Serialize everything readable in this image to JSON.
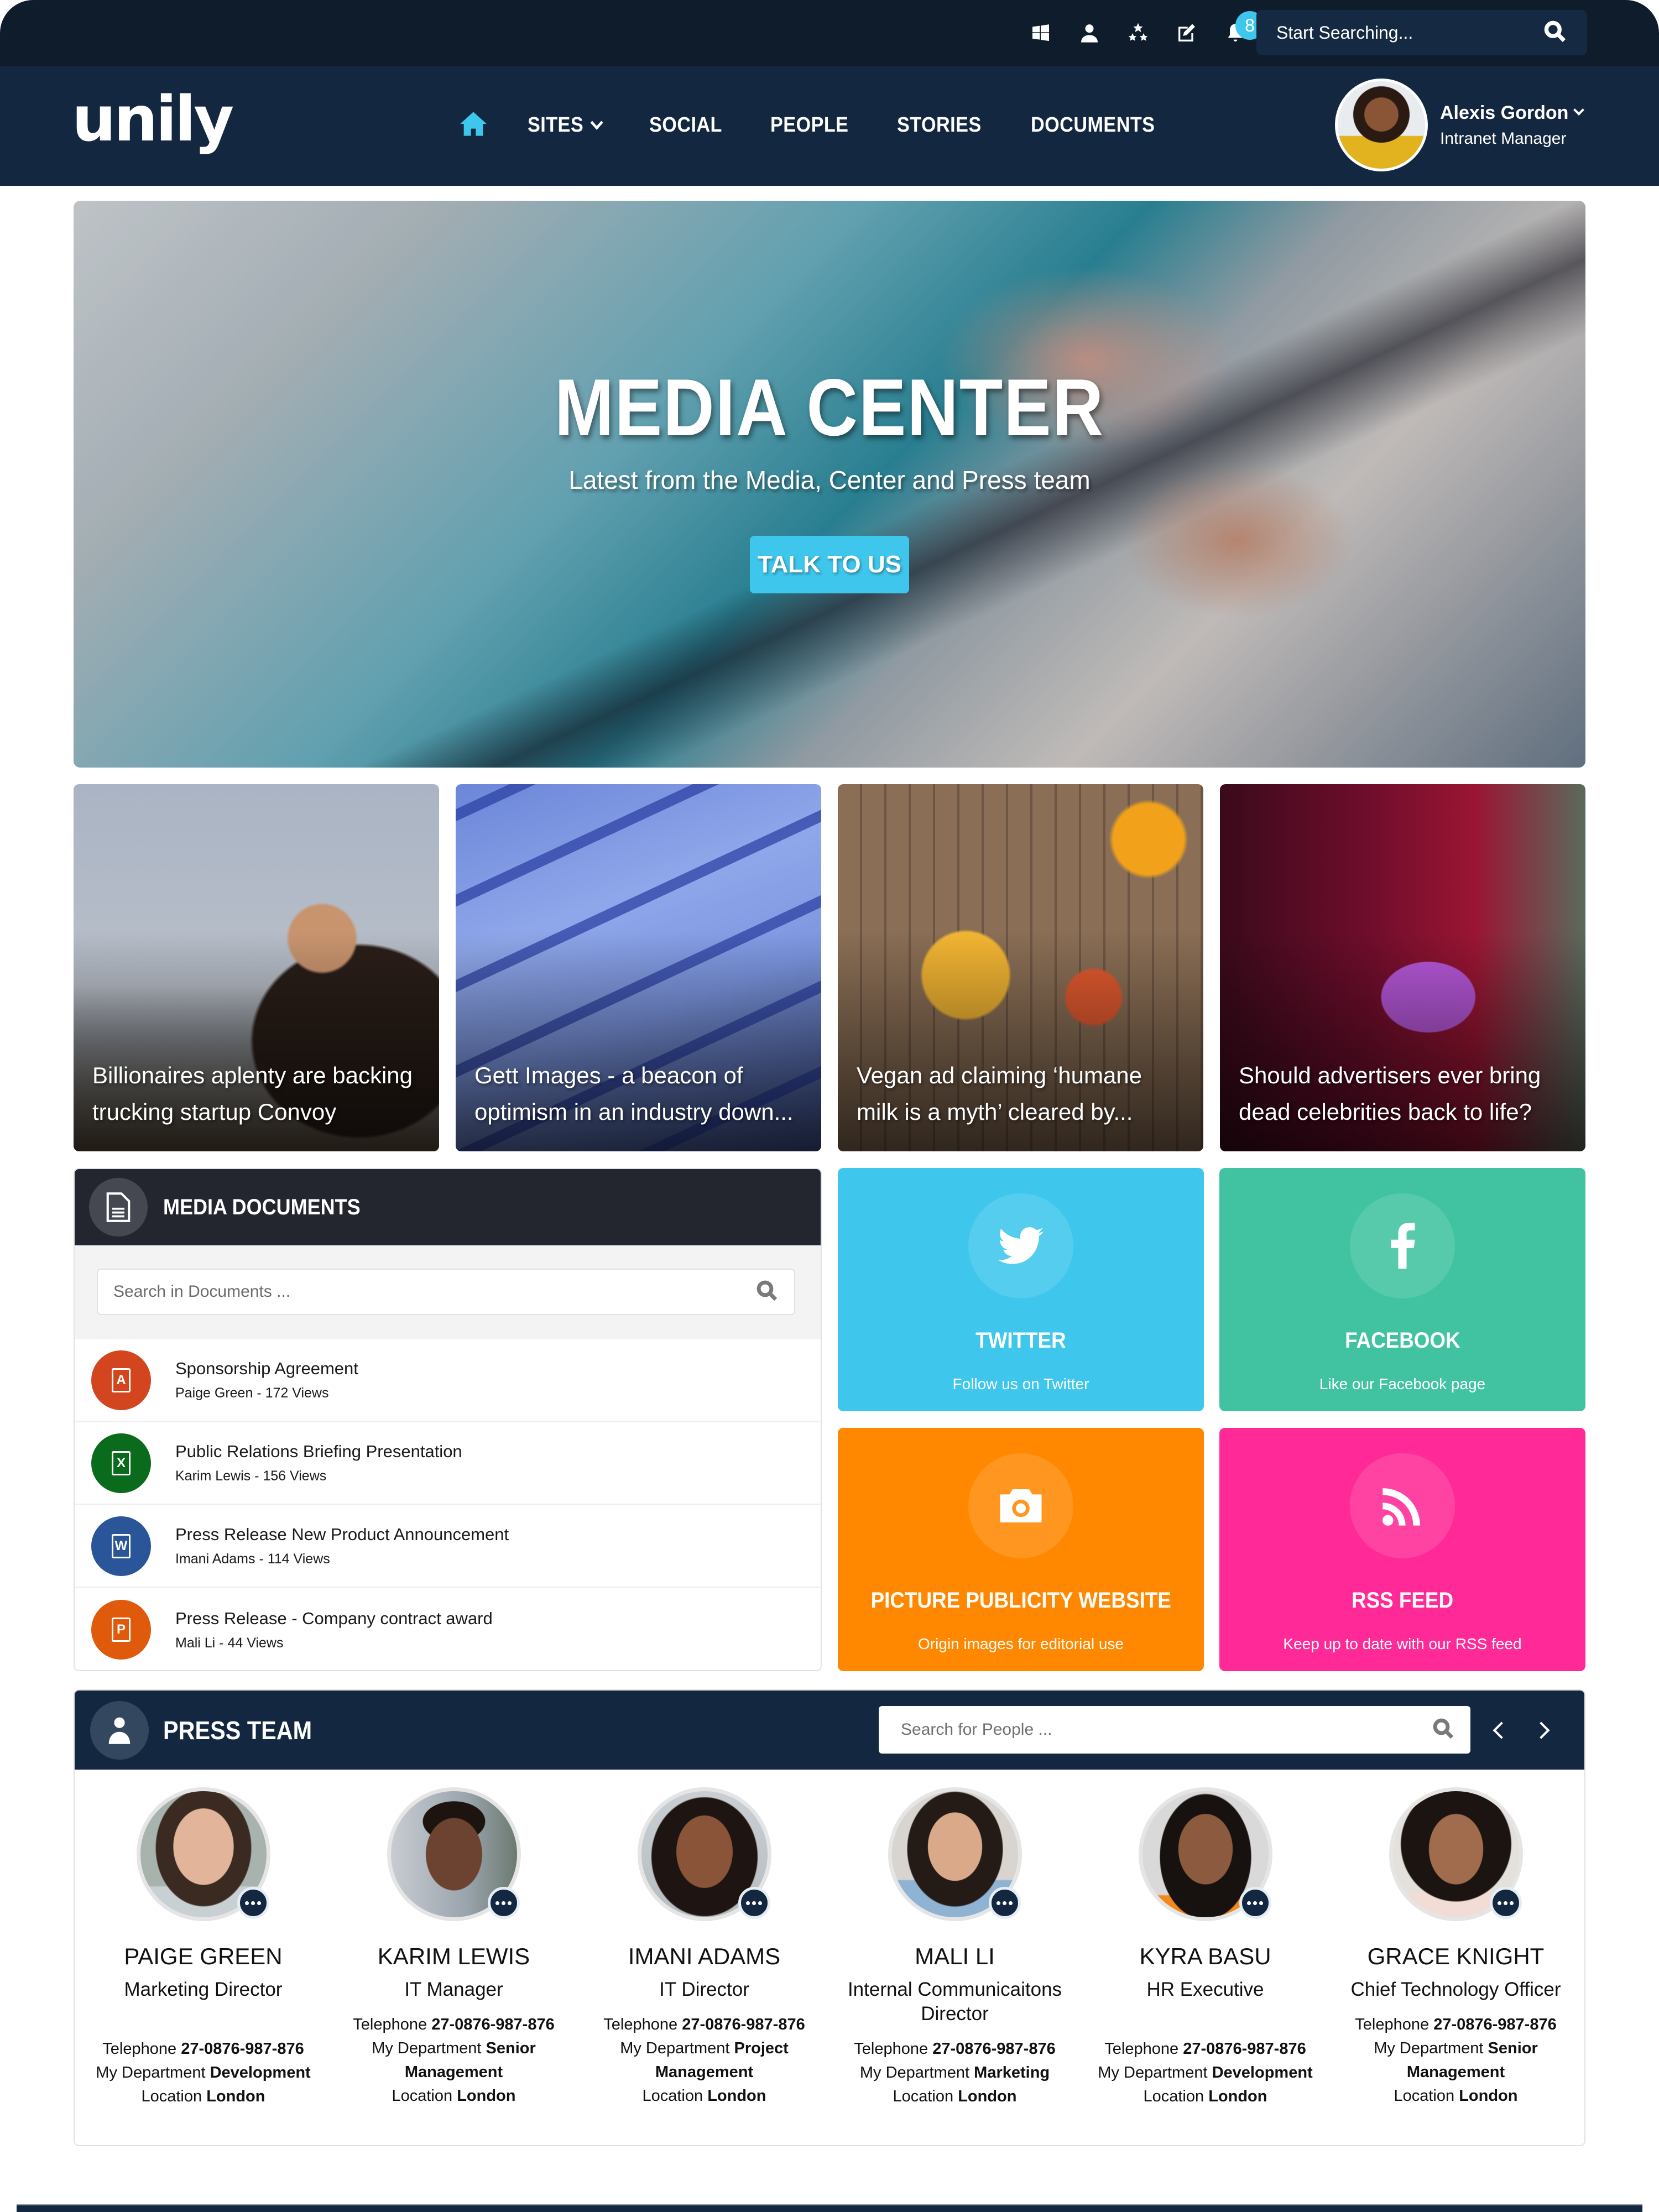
{
  "utility_bar": {
    "icons": [
      "windows-icon",
      "user-icon",
      "stars-icon",
      "edit-icon",
      "bell-icon"
    ],
    "notification_count": "8",
    "search_placeholder": "Start Searching..."
  },
  "nav": {
    "logo": "unily",
    "items": [
      {
        "label": "SITES",
        "has_dropdown": true
      },
      {
        "label": "SOCIAL"
      },
      {
        "label": "PEOPLE"
      },
      {
        "label": "STORIES"
      },
      {
        "label": "DOCUMENTS"
      }
    ],
    "user": {
      "name": "Alexis Gordon",
      "role": "Intranet Manager"
    }
  },
  "hero": {
    "title": "MEDIA CENTER",
    "subtitle": "Latest from the Media, Center and Press team",
    "cta": "TALK TO US"
  },
  "news": [
    {
      "title": "Billionaires aplenty are backing trucking startup Convoy"
    },
    {
      "title": "Gett Images - a beacon of optimism in an industry down..."
    },
    {
      "title": "Vegan ad claiming ‘humane milk is a myth’ cleared by..."
    },
    {
      "title": "Should advertisers ever bring dead celebrities back to life?"
    }
  ],
  "documents": {
    "title": "MEDIA DOCUMENTS",
    "search_placeholder": "Search in Documents ...",
    "items": [
      {
        "title": "Sponsorship Agreement",
        "meta": "Paige Green - 172 Views",
        "type": "pdf",
        "glyph": "A",
        "color": "#d2451e"
      },
      {
        "title": "Public Relations Briefing Presentation",
        "meta": "Karim Lewis - 156 Views",
        "type": "excel",
        "glyph": "X",
        "color": "#0a6b1c"
      },
      {
        "title": "Press Release  New Product Announcement",
        "meta": "Imani Adams - 114 Views",
        "type": "word",
        "glyph": "W",
        "color": "#2a5699"
      },
      {
        "title": "Press Release - Company contract award",
        "meta": "Mali Li - 44 Views",
        "type": "powerpoint",
        "glyph": "P",
        "color": "#e05a0c"
      }
    ]
  },
  "tiles": [
    {
      "title": "TWITTER",
      "subtitle": "Follow us on Twitter",
      "icon": "twitter-icon",
      "color": "#3ec6ec"
    },
    {
      "title": "FACEBOOK",
      "subtitle": "Like our Facebook page",
      "icon": "facebook-icon",
      "color": "#41c3a1"
    },
    {
      "title": "PICTURE PUBLICITY WEBSITE",
      "subtitle": "Origin images for editorial use",
      "icon": "camera-icon",
      "color": "#ff8800"
    },
    {
      "title": "RSS FEED",
      "subtitle": "Keep up to date with our RSS feed",
      "icon": "rss-icon",
      "color": "#ff2a97"
    }
  ],
  "press_team": {
    "title": "PRESS TEAM",
    "search_placeholder": "Search for People ...",
    "labels": {
      "telephone": "Telephone",
      "department": "My Department",
      "location": "Location"
    },
    "people": [
      {
        "name": "PAIGE GREEN",
        "role": "Marketing Director",
        "telephone": "27-0876-987-876",
        "department": "Development",
        "location": "London"
      },
      {
        "name": "KARIM LEWIS",
        "role": "IT Manager",
        "telephone": "27-0876-987-876",
        "department": "Senior Management",
        "location": "London"
      },
      {
        "name": "IMANI ADAMS",
        "role": "IT Director",
        "telephone": "27-0876-987-876",
        "department": "Project Management",
        "location": "London"
      },
      {
        "name": "MALI LI",
        "role": "Internal Communicaitons Director",
        "telephone": "27-0876-987-876",
        "department": "Marketing",
        "location": "London"
      },
      {
        "name": "KYRA BASU",
        "role": "HR Executive",
        "telephone": "27-0876-987-876",
        "department": "Development",
        "location": "London"
      },
      {
        "name": "GRACE KNIGHT",
        "role": "Chief Technology Officer",
        "telephone": "27-0876-987-876",
        "department": "Senior Management",
        "location": "London"
      }
    ]
  }
}
